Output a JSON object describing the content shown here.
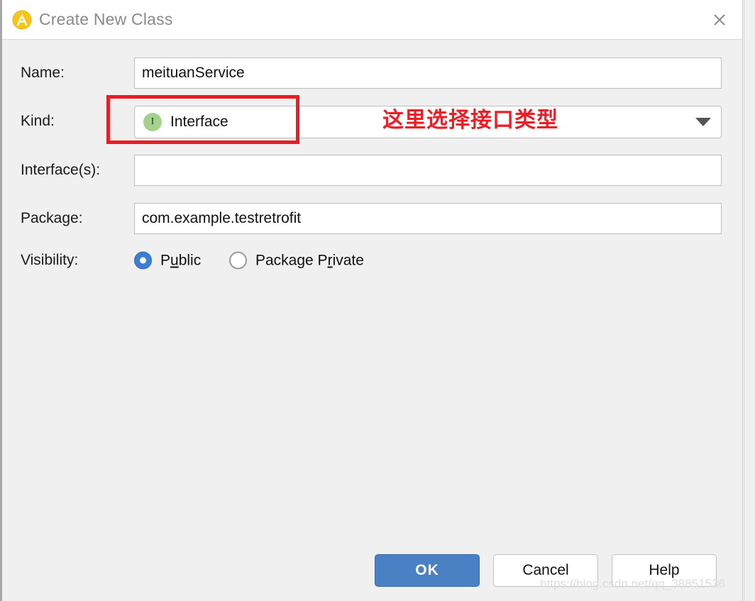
{
  "window": {
    "title": "Create New Class",
    "app_icon": "android-studio-icon",
    "close_icon": "close-icon",
    "colors": {
      "titlebar_bg": "#ffffff",
      "body_bg": "#f0f0f0",
      "title_text": "#8a8a8a",
      "accent_blue": "#4a81c4",
      "annotation_red": "#ec1c24",
      "interface_icon_green": "#a4d28b",
      "radio_blue": "#3b7fd4"
    }
  },
  "form": {
    "name": {
      "label": "Name:",
      "value": "meituanService",
      "placeholder": ""
    },
    "kind": {
      "label": "Kind:",
      "selected": "Interface",
      "icon": "interface-icon",
      "icon_letter": "I",
      "dropdown_icon": "chevron-down-icon",
      "options": [
        "Interface"
      ]
    },
    "interfaces": {
      "label": "Interface(s):",
      "value": "",
      "placeholder": ""
    },
    "package": {
      "label": "Package:",
      "value": "com.example.testretrofit",
      "placeholder": ""
    },
    "visibility": {
      "label": "Visibility:",
      "options": [
        {
          "label_before": "P",
          "mnemonic": "u",
          "label_after": "blic",
          "full": "Public",
          "selected": true
        },
        {
          "label_before": "Package P",
          "mnemonic": "r",
          "label_after": "ivate",
          "full": "Package Private",
          "selected": false
        }
      ]
    }
  },
  "annotation": {
    "text": "这里选择接口类型",
    "color": "#ee1c25"
  },
  "buttons": {
    "ok": "OK",
    "cancel": "Cancel",
    "help": "Help"
  },
  "watermark": {
    "text": "https://blog.csdn.net/qq_38851536"
  }
}
